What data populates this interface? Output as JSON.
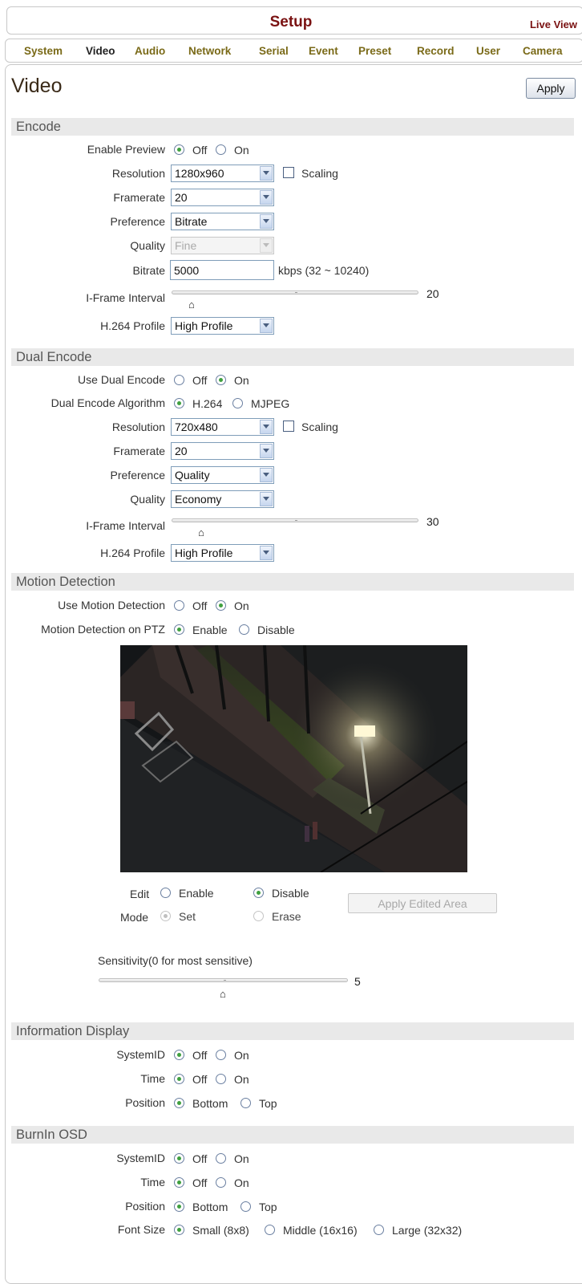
{
  "header": {
    "title": "Setup",
    "live_view": "Live View"
  },
  "nav": {
    "items": [
      {
        "label": "System"
      },
      {
        "label": "Video"
      },
      {
        "label": "Audio"
      },
      {
        "label": "Network"
      },
      {
        "label": "Serial"
      },
      {
        "label": "Event"
      },
      {
        "label": "Preset"
      },
      {
        "label": "Record"
      },
      {
        "label": "User"
      },
      {
        "label": "Camera"
      }
    ],
    "active": "Video"
  },
  "page": {
    "title": "Video",
    "apply_label": "Apply"
  },
  "encode": {
    "title": "Encode",
    "enable_preview": {
      "label": "Enable Preview",
      "off": "Off",
      "on": "On",
      "value": "Off"
    },
    "resolution": {
      "label": "Resolution",
      "value": "1280x960",
      "scaling_label": "Scaling",
      "scaling_checked": false
    },
    "framerate": {
      "label": "Framerate",
      "value": "20"
    },
    "preference": {
      "label": "Preference",
      "value": "Bitrate"
    },
    "quality": {
      "label": "Quality",
      "value": "Fine",
      "disabled": true
    },
    "bitrate": {
      "label": "Bitrate",
      "value": "5000",
      "unit": "kbps (32 ~ 10240)"
    },
    "iframe": {
      "label": "I-Frame Interval",
      "value": "20",
      "fraction": 0.09
    },
    "profile": {
      "label": "H.264 Profile",
      "value": "High Profile"
    }
  },
  "dual": {
    "title": "Dual Encode",
    "use": {
      "label": "Use Dual Encode",
      "off": "Off",
      "on": "On",
      "value": "On"
    },
    "algorithm": {
      "label": "Dual Encode Algorithm",
      "h264": "H.264",
      "mjpeg": "MJPEG",
      "value": "H.264"
    },
    "resolution": {
      "label": "Resolution",
      "value": "720x480",
      "scaling_label": "Scaling",
      "scaling_checked": false
    },
    "framerate": {
      "label": "Framerate",
      "value": "20"
    },
    "preference": {
      "label": "Preference",
      "value": "Quality"
    },
    "quality": {
      "label": "Quality",
      "value": "Economy"
    },
    "iframe": {
      "label": "I-Frame Interval",
      "value": "30",
      "fraction": 0.13
    },
    "profile": {
      "label": "H.264 Profile",
      "value": "High Profile"
    }
  },
  "motion": {
    "title": "Motion Detection",
    "use": {
      "label": "Use Motion Detection",
      "off": "Off",
      "on": "On",
      "value": "On"
    },
    "ptz": {
      "label": "Motion Detection on PTZ",
      "enable": "Enable",
      "disable": "Disable",
      "value": "Enable"
    },
    "edit": {
      "label": "Edit",
      "enable": "Enable",
      "disable": "Disable",
      "value": "Disable"
    },
    "mode": {
      "label": "Mode",
      "set": "Set",
      "erase": "Erase",
      "value": "Set"
    },
    "apply_area_label": "Apply Edited Area",
    "sensitivity": {
      "label": "Sensitivity(0 for most sensitive)",
      "value": "5",
      "fraction": 0.5
    }
  },
  "info": {
    "title": "Information Display",
    "systemid": {
      "label": "SystemID",
      "off": "Off",
      "on": "On",
      "value": "Off"
    },
    "time": {
      "label": "Time",
      "off": "Off",
      "on": "On",
      "value": "Off"
    },
    "position": {
      "label": "Position",
      "bottom": "Bottom",
      "top": "Top",
      "value": "Bottom"
    }
  },
  "burnin": {
    "title": "BurnIn OSD",
    "systemid": {
      "label": "SystemID",
      "off": "Off",
      "on": "On",
      "value": "Off"
    },
    "time": {
      "label": "Time",
      "off": "Off",
      "on": "On",
      "value": "Off"
    },
    "position": {
      "label": "Position",
      "bottom": "Bottom",
      "top": "Top",
      "value": "Bottom"
    },
    "font_size": {
      "label": "Font Size",
      "small": "Small (8x8)",
      "middle": "Middle (16x16)",
      "large": "Large (32x32)",
      "value": "Small"
    }
  },
  "colors": {
    "brand": "#7a1212",
    "nav": "#7a6a18",
    "radio_dot": "#3fa03f",
    "section_bg": "#e9e9e9"
  }
}
